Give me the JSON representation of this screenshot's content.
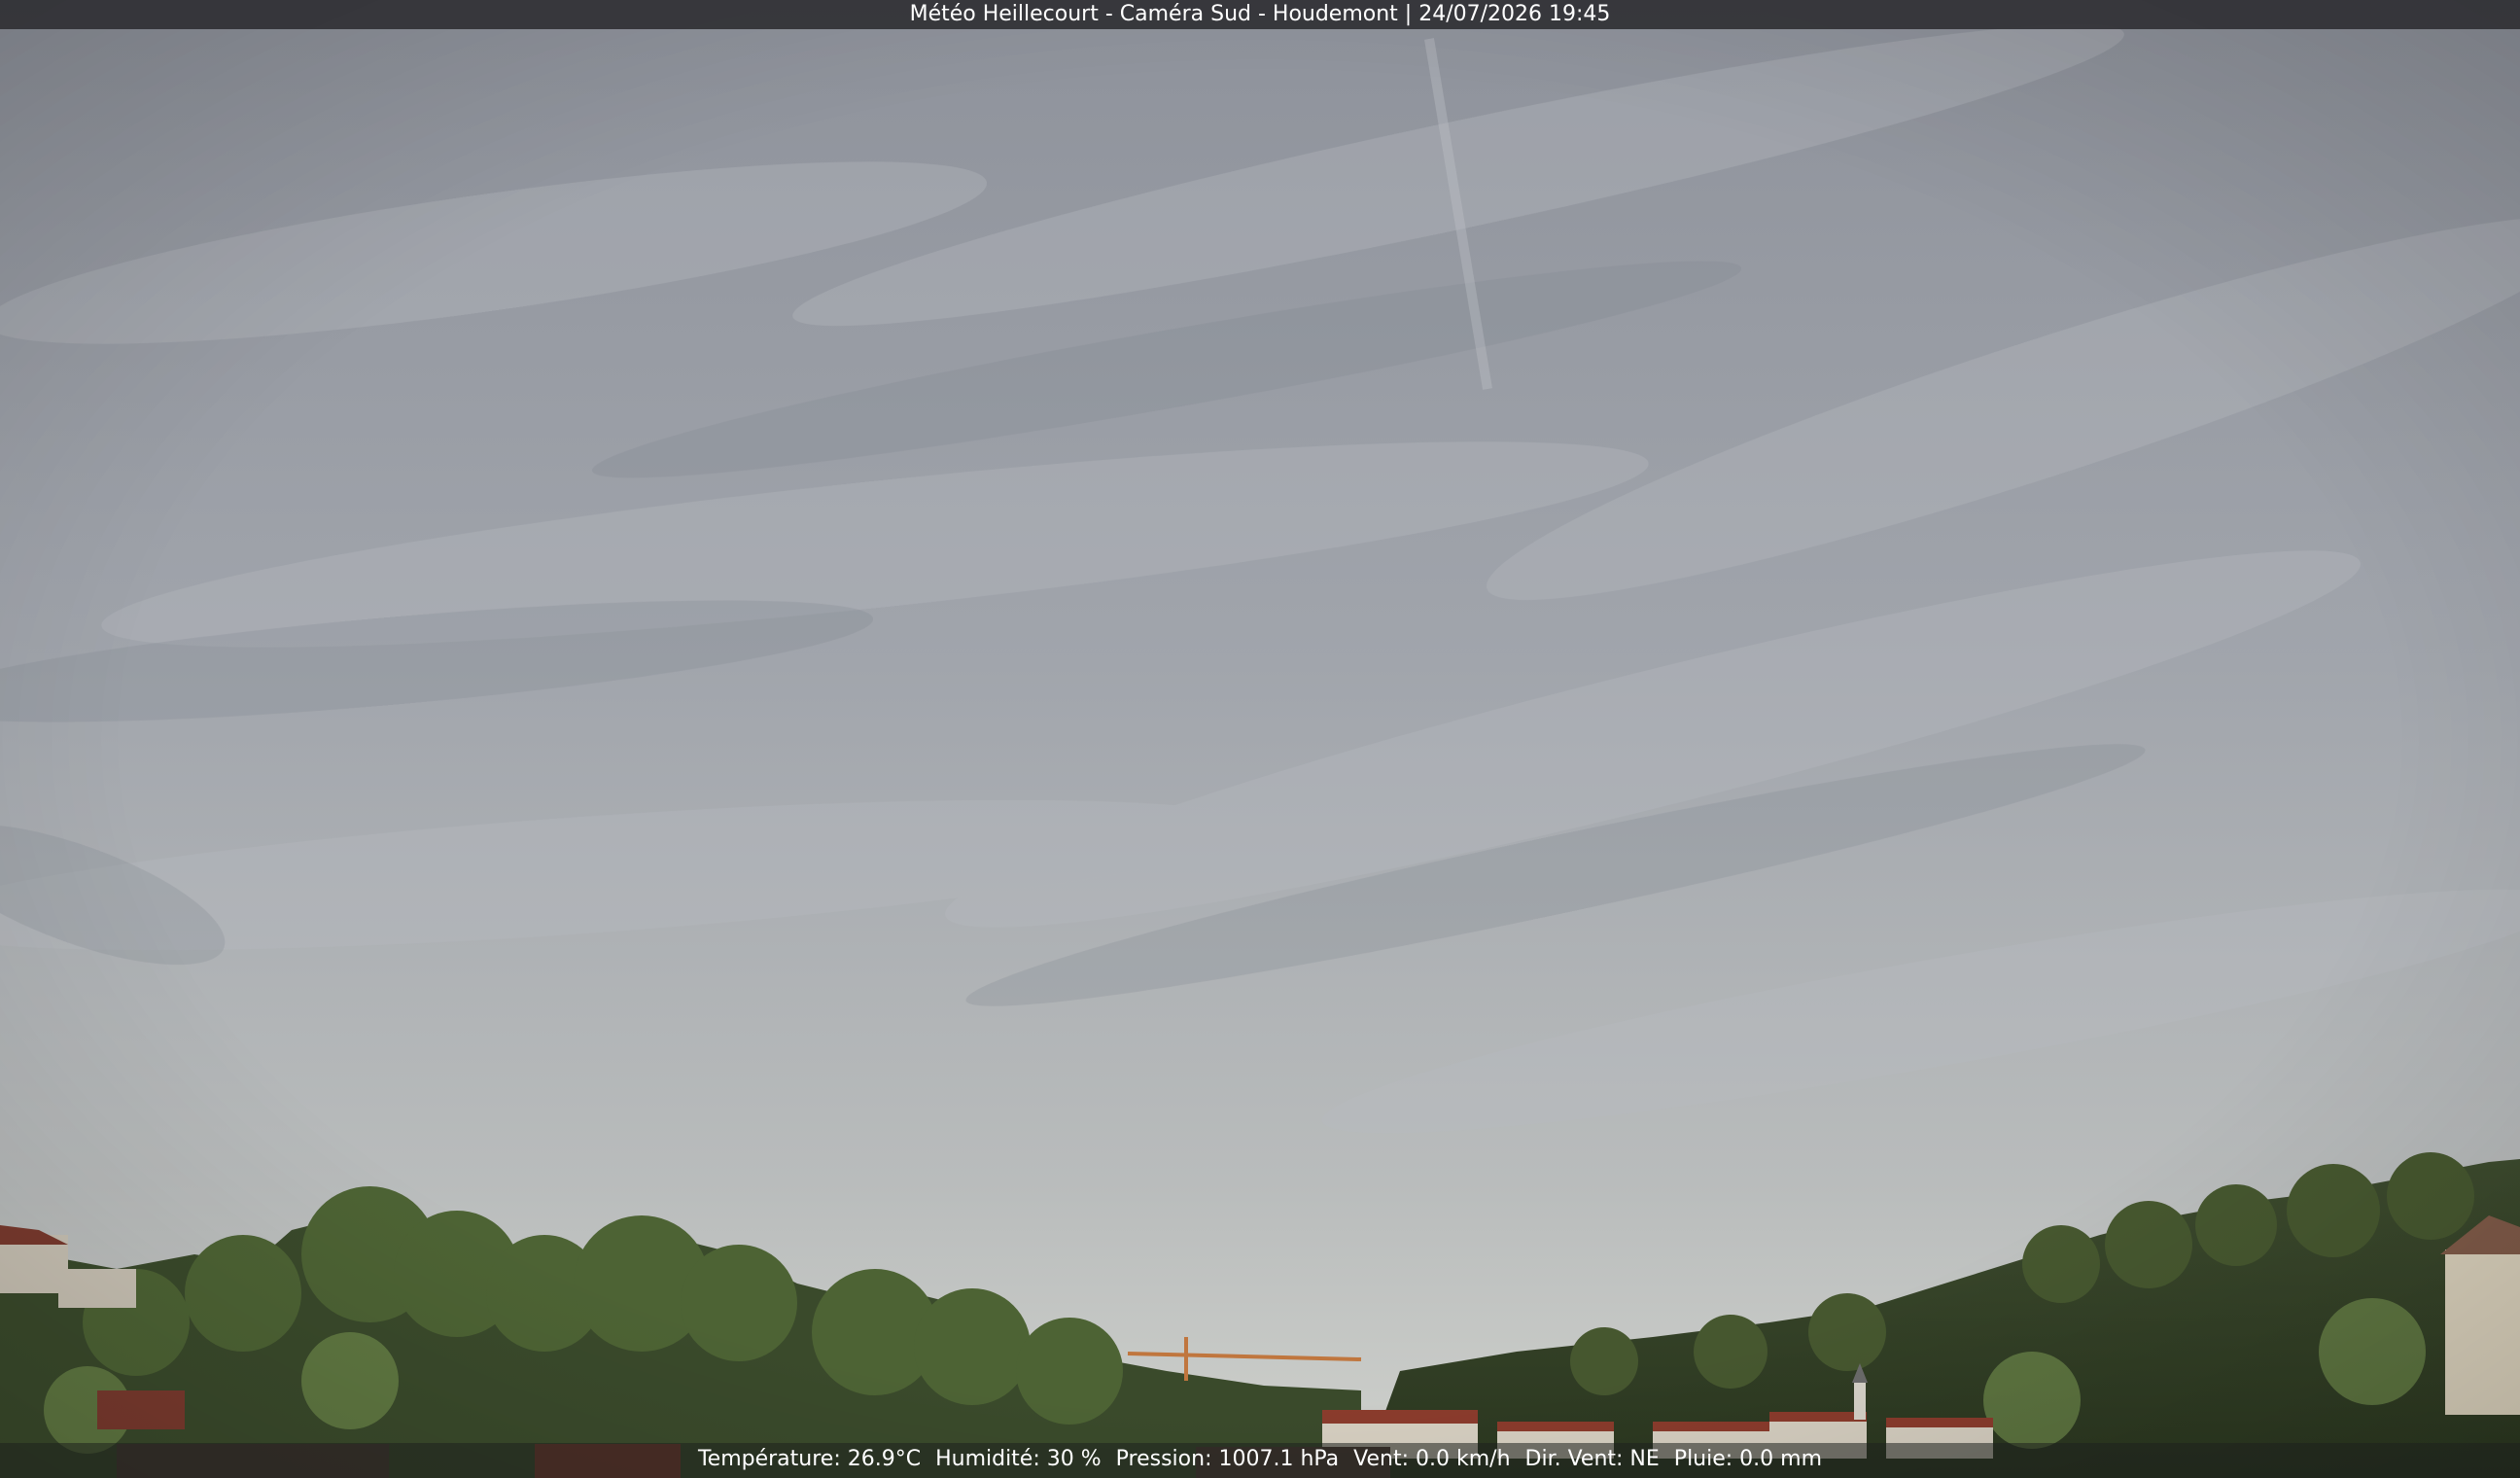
{
  "camera": {
    "title": "Météo Heillecourt - Caméra Sud - Houdemont | 24/07/2026 19:45"
  },
  "weather": {
    "temperature": "Température: 26.9°C",
    "humidity": "Humidité: 30 %",
    "pressure": "Pression: 1007.1 hPa",
    "wind_speed": "Vent: 0.0 km/h",
    "wind_direction": "Dir. Vent: NE",
    "rain": "Pluie: 0.0 mm"
  },
  "colors": {
    "sky_top": "#8f939c",
    "sky_mid": "#a2a6ad",
    "sky_horizon": "#c6c9c6",
    "foliage_dark": "#2f3d24",
    "foliage_light": "#5f7a3e",
    "roof_red": "#8a3b2c",
    "overlay_bar": "#2e2e32"
  }
}
